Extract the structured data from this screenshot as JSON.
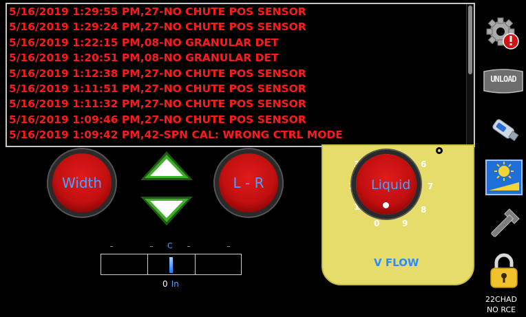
{
  "alarm_log": {
    "rows": [
      "5/16/2019 1:29:55 PM,27-NO CHUTE POS SENSOR",
      "5/16/2019 1:29:24 PM,27-NO CHUTE POS SENSOR",
      "5/16/2019 1:22:15 PM,08-NO GRANULAR DET",
      "5/16/2019 1:20:51 PM,08-NO GRANULAR DET",
      "5/16/2019 1:12:38 PM,27-NO CHUTE POS SENSOR",
      "5/16/2019 1:11:51 PM,27-NO CHUTE POS SENSOR",
      "5/16/2019 1:11:32 PM,27-NO CHUTE POS SENSOR",
      "5/16/2019 1:09:46 PM,27-NO CHUTE POS SENSOR",
      "5/16/2019 1:09:42 PM,42-SPN CAL: WRONG CTRL MODE"
    ],
    "text_color": "#ff1a1a"
  },
  "controls": {
    "width_label": "Width",
    "lr_label": "L - R",
    "up_arrow_icon": "arrow-up-icon",
    "down_arrow_icon": "arrow-down-icon",
    "arrow_color": "#3fae2a"
  },
  "scale": {
    "center_label": "C",
    "value": "0",
    "unit": "In"
  },
  "flow_panel": {
    "knob_label": "Liquid",
    "dial_numbers": [
      "0",
      "1",
      "2",
      "3",
      "6",
      "7",
      "8",
      "9"
    ],
    "title": "V FLOW",
    "panel_color": "#e6dc6a"
  },
  "sidebar": {
    "icons": [
      "settings-alert-icon",
      "unload-icon",
      "usb-drive-icon",
      "brightness-icon",
      "wrench-icon",
      "lock-icon"
    ],
    "unload_text": "UNLOAD"
  },
  "status": {
    "line1": "22CHAD",
    "line2": "NO RCE"
  }
}
